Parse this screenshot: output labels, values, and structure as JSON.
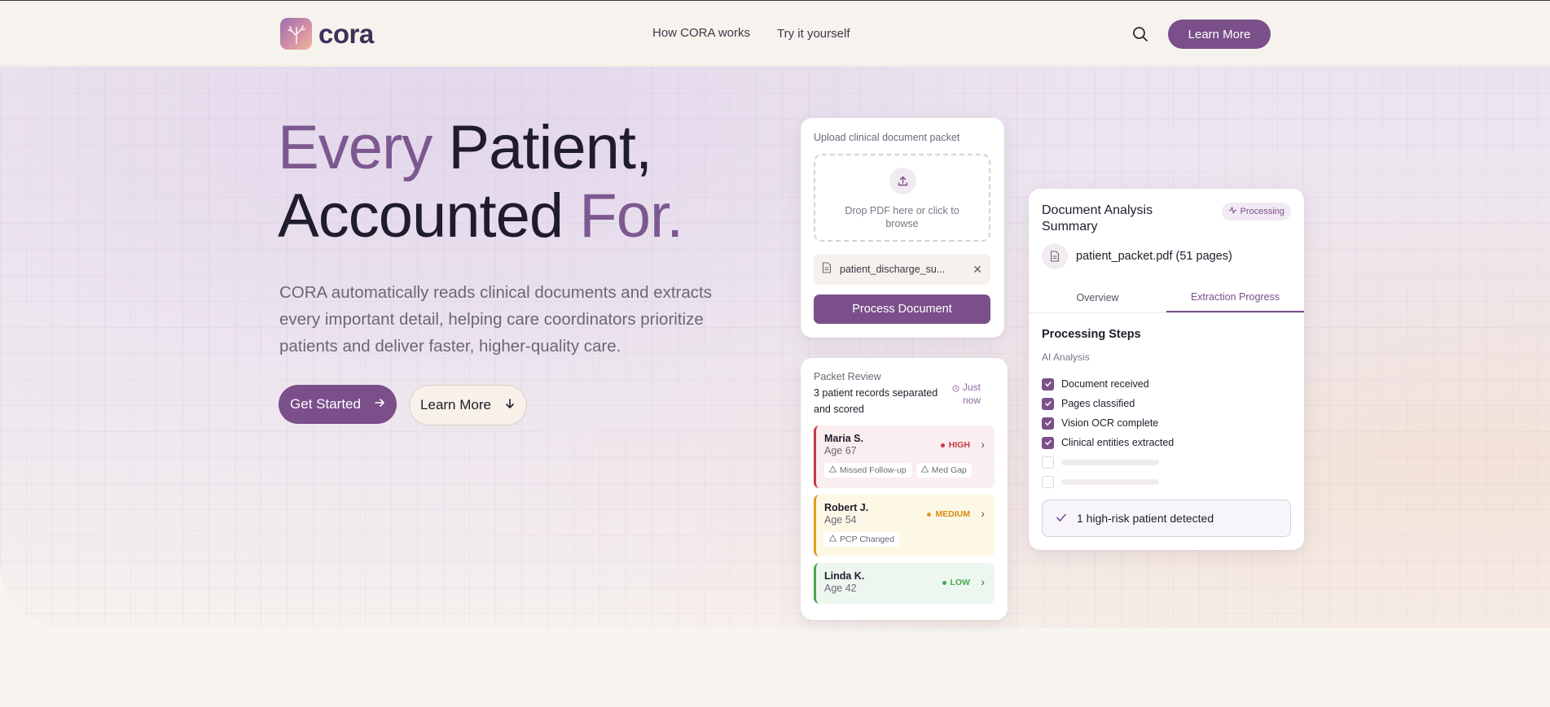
{
  "header": {
    "brand": "cora",
    "nav": [
      "How CORA works",
      "Try it yourself"
    ],
    "cta": "Learn More"
  },
  "hero": {
    "headline": {
      "w1": "Every",
      "w2": " Patient,",
      "w3": "Accounted ",
      "w4": "For."
    },
    "subtext": "CORA automatically reads clinical documents and extracts every important detail, helping care coordinators prioritize patients and deliver faster, higher-quality care.",
    "primary_cta": "Get Started",
    "secondary_cta": "Learn More"
  },
  "upload": {
    "label": "Upload clinical document packet",
    "drop_text": "Drop PDF here or click to browse",
    "file_name": "patient_discharge_su...",
    "process_button": "Process Document"
  },
  "packet": {
    "title": "Packet Review",
    "description": "3 patient records separated and scored",
    "timestamp": "Just now",
    "patients": [
      {
        "name": "Maria S.",
        "age": "Age 67",
        "risk": "HIGH",
        "risk_color": "#c23a45",
        "tags": [
          "Missed Follow-up",
          "Med Gap"
        ]
      },
      {
        "name": "Robert J.",
        "age": "Age 54",
        "risk": "MEDIUM",
        "risk_color": "#d98a12",
        "tags": [
          "PCP Changed"
        ]
      },
      {
        "name": "Linda K.",
        "age": "Age 42",
        "risk": "LOW",
        "risk_color": "#45a84f",
        "tags": []
      }
    ]
  },
  "analysis": {
    "title": "Document Analysis Summary",
    "status": "Processing",
    "file": "patient_packet.pdf (51 pages)",
    "tabs": [
      "Overview",
      "Extraction Progress"
    ],
    "active_tab": "Extraction Progress",
    "steps_title": "Processing Steps",
    "steps_subtitle": "AI Analysis",
    "steps": [
      "Document received",
      "Pages classified",
      "Vision OCR complete",
      "Clinical entities extracted"
    ],
    "alert": "1 high-risk patient detected"
  },
  "colors": {
    "brand": "#7a4f8a",
    "accent_text": "#7d5890",
    "high": "#c23a45",
    "medium": "#d98a12",
    "low": "#45a84f"
  }
}
